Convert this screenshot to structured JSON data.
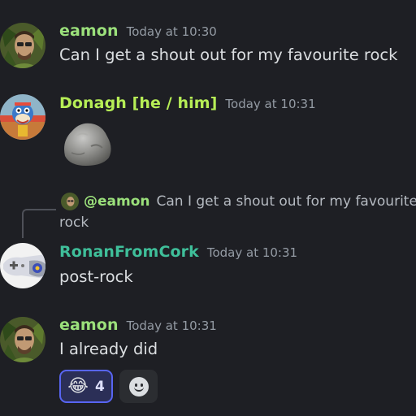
{
  "colors": {
    "background": "#1e1f24",
    "eamon": "#9be07b",
    "donagh": "#b6ee56",
    "ronan": "#3fbf9a",
    "timestamp": "#949ba4",
    "reaction_accent": "#5865f2"
  },
  "messages": [
    {
      "username": "eamon",
      "timestamp": "Today at 10:30",
      "text": "Can I get a shout out for my favourite rock",
      "avatar": "jungle-man-avatar"
    },
    {
      "username": "Donagh [he / him]",
      "timestamp": "Today at 10:31",
      "attachment": "rock-image",
      "avatar": "cartoon-avatar"
    },
    {
      "username": "RonanFromCork",
      "timestamp": "Today at 10:31",
      "text": "post-rock",
      "avatar": "controller-avatar",
      "reply": {
        "mention": "@eamon",
        "text": "Can I get a shout out for my favourite",
        "text_wrap": "rock"
      }
    },
    {
      "username": "eamon",
      "timestamp": "Today at 10:31",
      "text": "I already did",
      "avatar": "jungle-man-avatar",
      "reactions": [
        {
          "emoji": "😂",
          "count": "4",
          "active": true
        }
      ]
    }
  ]
}
